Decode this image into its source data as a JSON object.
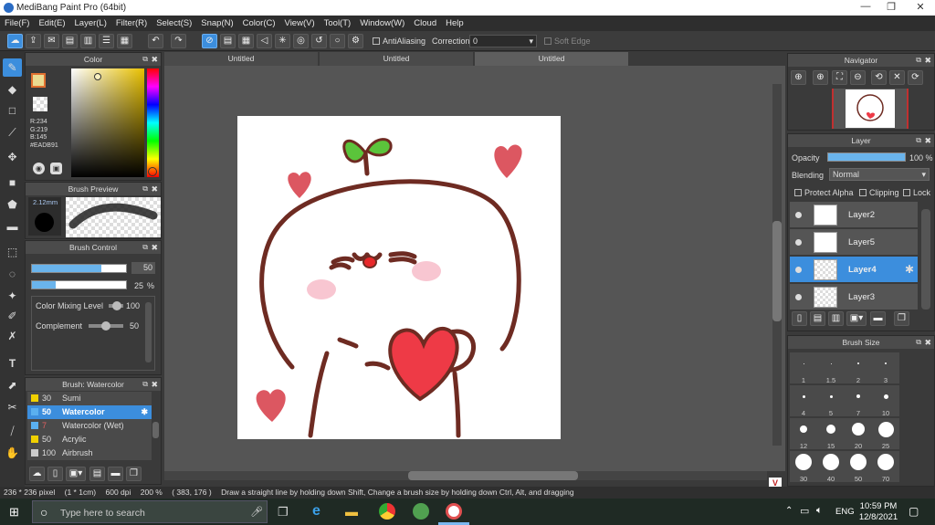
{
  "window": {
    "title": "MediBang Paint Pro (64bit)",
    "min": "—",
    "max": "❐",
    "close": "✕"
  },
  "menu": [
    "File(F)",
    "Edit(E)",
    "Layer(L)",
    "Filter(R)",
    "Select(S)",
    "Snap(N)",
    "Color(C)",
    "View(V)",
    "Tool(T)",
    "Window(W)",
    "Cloud",
    "Help"
  ],
  "toolbar": {
    "antialiasing": "AntiAliasing",
    "correction_label": "Correction",
    "correction_value": "0",
    "soft_edge": "Soft Edge"
  },
  "tabs": [
    "Untitled",
    "Untitled",
    "Untitled"
  ],
  "color_panel": {
    "title": "Color",
    "r": "R:234",
    "g": "G:219",
    "b": "B:145",
    "hex": "#EADB91",
    "fg": "#EADB91"
  },
  "brush_preview": {
    "title": "Brush Preview",
    "size": "2.12mm"
  },
  "brush_control": {
    "title": "Brush Control",
    "size_value": "50",
    "opacity_value": "25",
    "opacity_unit": "%",
    "mixing_label": "Color Mixing Level",
    "mixing_value": "100",
    "complement_label": "Complement",
    "complement_value": "50",
    "size_fill": 0.74,
    "opacity_fill": 0.25
  },
  "brush_list": {
    "title": "Brush: Watercolor",
    "items": [
      {
        "size": "30",
        "name": "Sumi",
        "color": "#f0d000"
      },
      {
        "size": "50",
        "name": "Watercolor",
        "color": "#5ab0f0"
      },
      {
        "size": "7",
        "name": "Watercolor (Wet)",
        "color": "#5ab0f0"
      },
      {
        "size": "50",
        "name": "Acrylic",
        "color": "#f0d000"
      },
      {
        "size": "100",
        "name": "Airbrush",
        "color": "#cccccc"
      }
    ]
  },
  "navigator": {
    "title": "Navigator"
  },
  "layer_panel": {
    "title": "Layer",
    "opacity_label": "Opacity",
    "opacity_value": "100 %",
    "blending_label": "Blending",
    "blending_value": "Normal",
    "protect_alpha": "Protect Alpha",
    "clipping": "Clipping",
    "lock": "Lock",
    "layers": [
      "Layer2",
      "Layer5",
      "Layer4",
      "Layer3"
    ],
    "selected": "Layer4"
  },
  "brush_size": {
    "title": "Brush Size",
    "sizes": [
      "1",
      "1.5",
      "2",
      "3",
      "4",
      "5",
      "7",
      "10",
      "12",
      "15",
      "20",
      "25",
      "30",
      "40",
      "50",
      "70"
    ]
  },
  "status": {
    "dims": "236 * 236 pixel",
    "unit": "(1 * 1cm)",
    "dpi": "600 dpi",
    "zoom": "200 %",
    "coords": "( 383, 176 )",
    "hint": "Draw a straight line by holding down Shift, Change a brush size by holding down Ctrl, Alt, and dragging"
  },
  "taskbar": {
    "search": "Type here to search",
    "lang": "ENG",
    "time": "10:59 PM",
    "date": "12/8/2021"
  }
}
